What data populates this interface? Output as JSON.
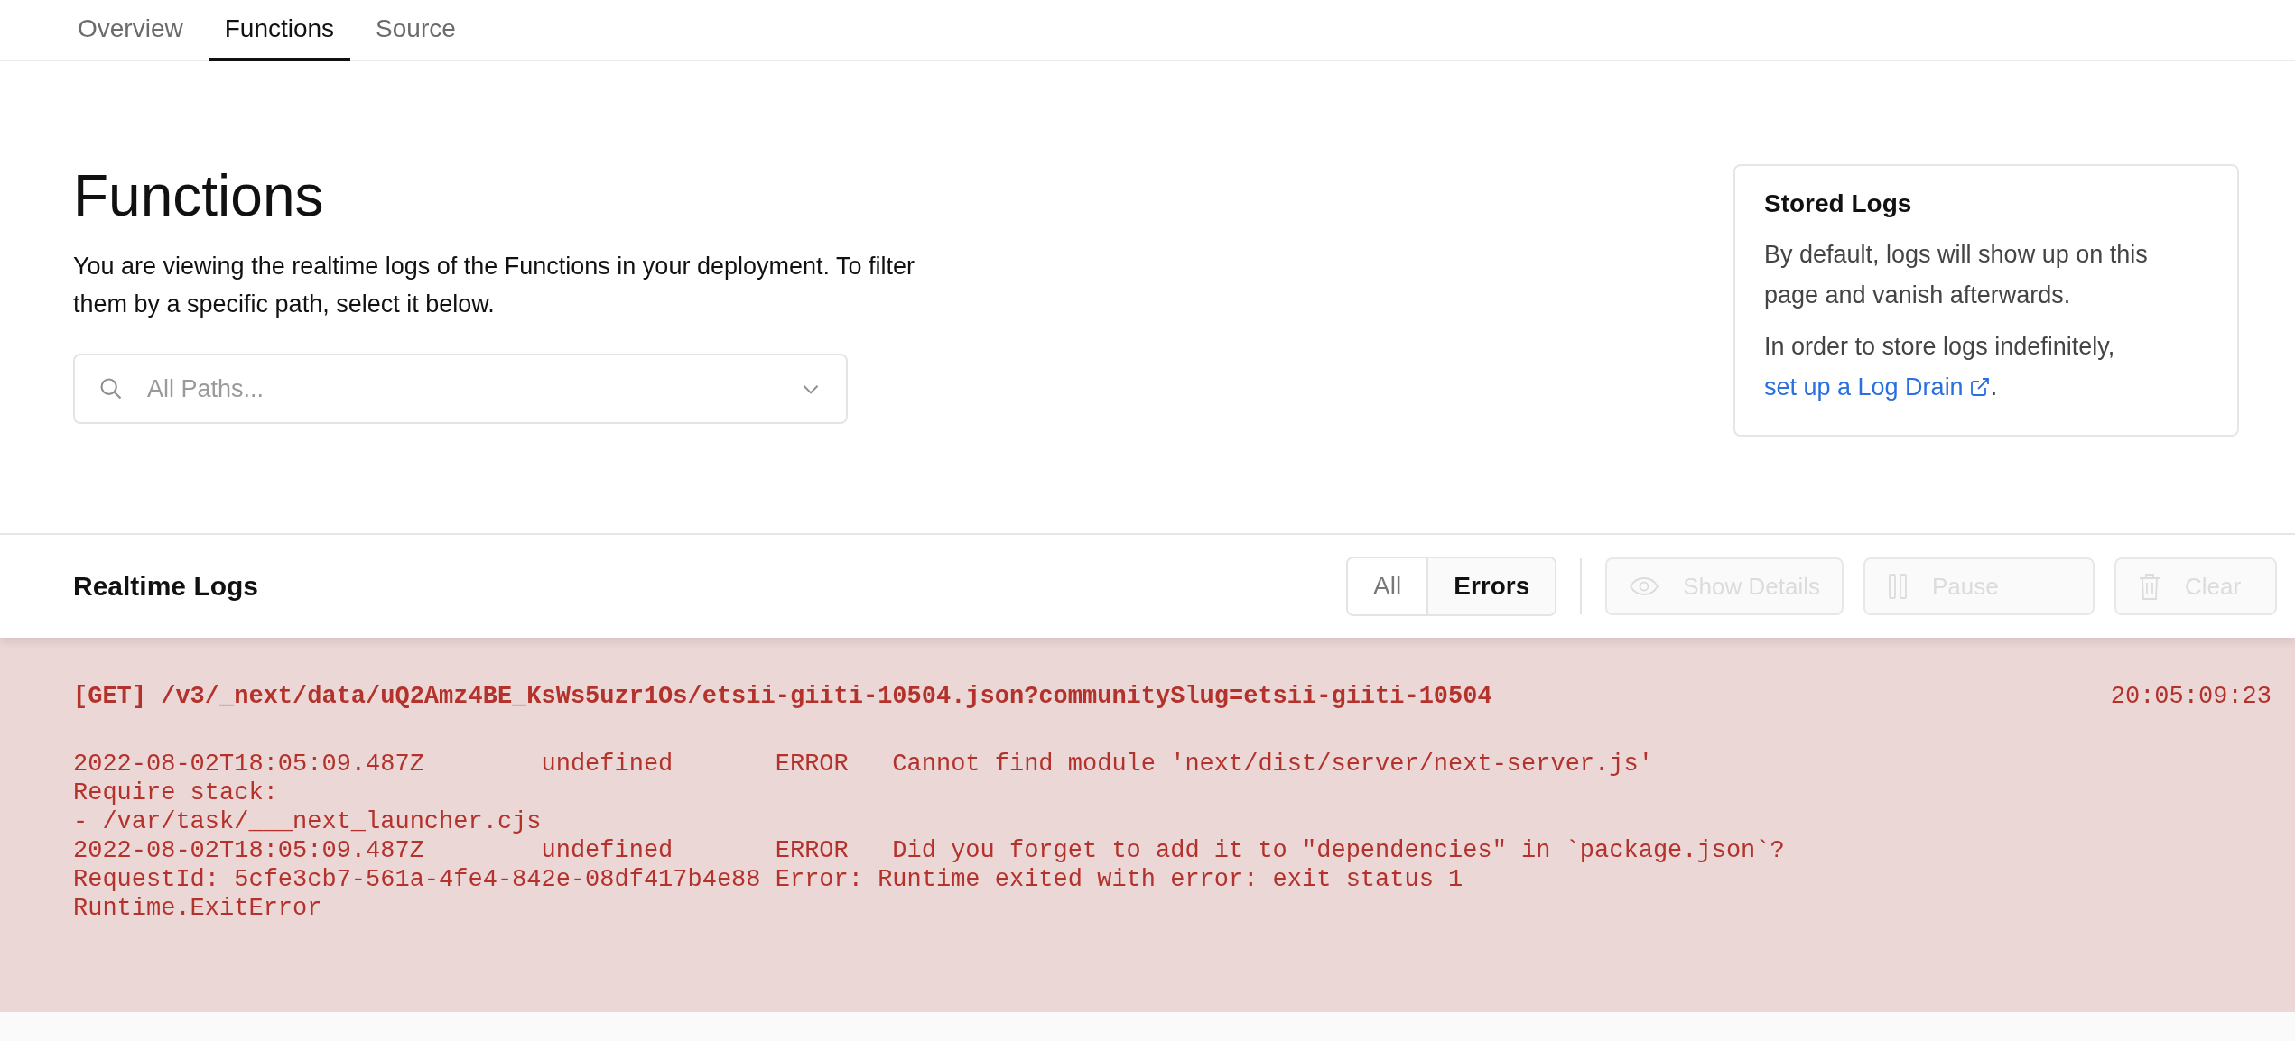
{
  "tabs": [
    {
      "label": "Overview",
      "selected": false
    },
    {
      "label": "Functions",
      "selected": true
    },
    {
      "label": "Source",
      "selected": false
    }
  ],
  "heading": "Functions",
  "description": "You are viewing the realtime logs of the Functions in your deployment. To filter them by a specific path, select it below.",
  "path_filter": {
    "placeholder": "All Paths..."
  },
  "stored_logs": {
    "title": "Stored Logs",
    "text": "By default, logs will show up on this page and vanish afterwards.",
    "text_2": "In order to store logs indefinitely,",
    "link": "set up a Log Drain",
    "after_link": "."
  },
  "realtime_logs": {
    "title": "Realtime Logs",
    "filters": [
      {
        "label": "All",
        "selected": false
      },
      {
        "label": "Errors",
        "selected": true
      }
    ],
    "actions": [
      {
        "kind": "details",
        "label": "Show Details",
        "disabled": true
      },
      {
        "kind": "pause",
        "label": "Pause",
        "disabled": true
      },
      {
        "kind": "clear",
        "label": "Clear",
        "disabled": true
      }
    ]
  },
  "log_entries": [
    {
      "request": "[GET] /v3/_next/data/uQ2Amz4BE_KsWs5uzr1Os/etsii-giiti-10504.json?communitySlug=etsii-giiti-10504",
      "time": "20:05:09:23",
      "lines": [
        "2022-08-02T18:05:09.487Z        undefined       ERROR   Cannot find module 'next/dist/server/next-server.js'",
        "Require stack:",
        "- /var/task/___next_launcher.cjs",
        "2022-08-02T18:05:09.487Z        undefined       ERROR   Did you forget to add it to \"dependencies\" in `package.json`?",
        "RequestId: 5cfe3cb7-561a-4fe4-842e-08df417b4e88 Error: Runtime exited with error: exit status 1",
        "Runtime.ExitError"
      ]
    }
  ]
}
